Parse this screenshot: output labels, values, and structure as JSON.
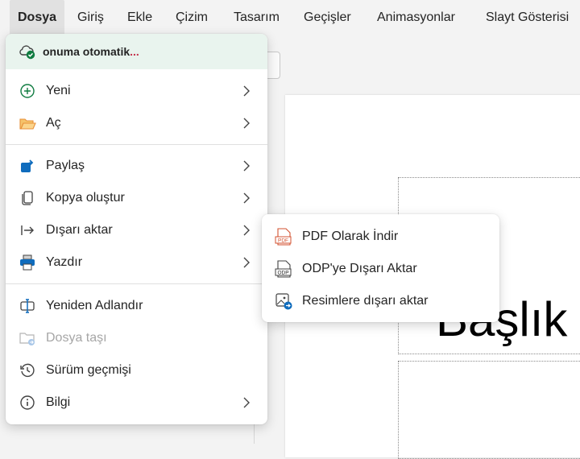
{
  "ribbon": {
    "tabs": [
      {
        "label": "Dosya",
        "active": true
      },
      {
        "label": "Giriş"
      },
      {
        "label": "Ekle"
      },
      {
        "label": "Çizim"
      },
      {
        "label": "Tasarım"
      },
      {
        "label": "Geçişler"
      },
      {
        "label": "Animasyonlar"
      },
      {
        "label": "Slayt Gösterisi"
      }
    ]
  },
  "file_menu": {
    "status": {
      "text": "onuma otomatik",
      "ellipsis": "...",
      "icon": "cloud-check-icon"
    },
    "items": [
      {
        "label": "Yeni",
        "icon": "add-circle-icon",
        "submenu": true
      },
      {
        "label": "Aç",
        "icon": "folder-open-icon",
        "submenu": true
      },
      {
        "label": "Paylaş",
        "icon": "share-icon",
        "submenu": true
      },
      {
        "label": "Kopya oluştur",
        "icon": "copy-icon",
        "submenu": true
      },
      {
        "label": "Dışarı aktar",
        "icon": "export-arrow-icon",
        "submenu": true
      },
      {
        "label": "Yazdır",
        "icon": "printer-icon",
        "submenu": true
      },
      {
        "label": "Yeniden Adlandır",
        "icon": "rename-icon",
        "submenu": false
      },
      {
        "label": "Dosya taşı",
        "icon": "move-folder-icon",
        "submenu": false,
        "disabled": true
      },
      {
        "label": "Sürüm geçmişi",
        "icon": "history-icon",
        "submenu": false
      },
      {
        "label": "Bilgi",
        "icon": "info-icon",
        "submenu": true
      }
    ]
  },
  "export_submenu": {
    "items": [
      {
        "label": "PDF Olarak İndir",
        "icon": "pdf-file-icon",
        "badge": "PDF"
      },
      {
        "label": "ODP'ye Dışarı Aktar",
        "icon": "odp-file-icon",
        "badge": "ODP"
      },
      {
        "label": "Resimlere dışarı aktar",
        "icon": "image-export-icon"
      }
    ]
  },
  "slide": {
    "title_text": "Başlık"
  },
  "colors": {
    "accent_green": "#107c41",
    "folder_orange": "#e8913a",
    "share_blue": "#0f6cbd",
    "pdf_orange": "#d35230"
  }
}
